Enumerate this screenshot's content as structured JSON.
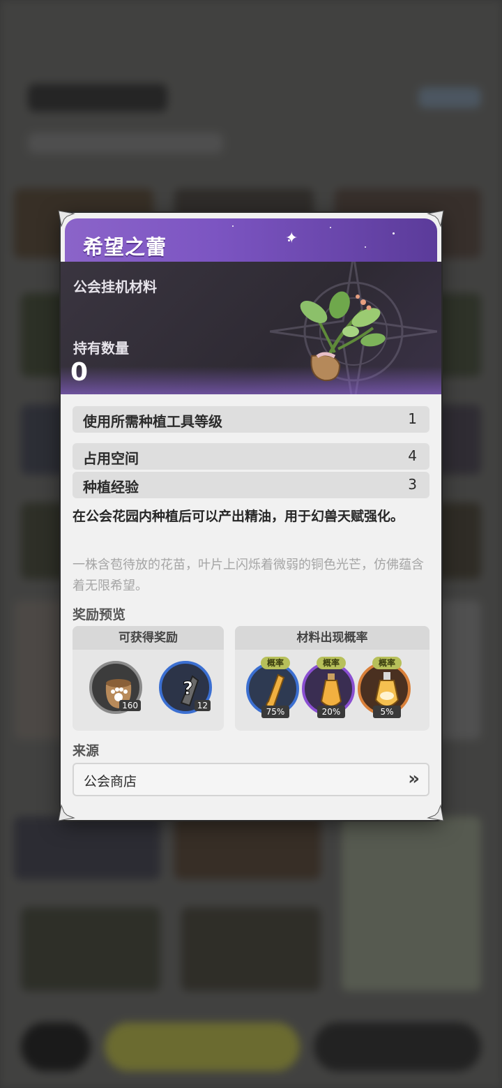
{
  "item": {
    "name": "希望之蕾",
    "category": "公会挂机材料",
    "own_label": "持有数量",
    "own_value": "0"
  },
  "stats": [
    {
      "label": "使用所需种植工具等级",
      "value": "1"
    },
    {
      "label": "占用空间",
      "value": "4"
    },
    {
      "label": "种植经验",
      "value": "3"
    }
  ],
  "description": "在公会花园内种植后可以产出精油，用于幻兽天赋强化。",
  "flavor": "一株含苞待放的花苗，叶片上闪烁着微弱的铜色光芒，仿佛蕴含着无限希望。",
  "rewards": {
    "section_label": "奖励预览",
    "obtainable": {
      "header": "可获得奖励",
      "items": [
        {
          "icon": "paw-sack-icon",
          "qty": "160"
        },
        {
          "icon": "mystery-item-icon",
          "qty": "12"
        }
      ]
    },
    "probability": {
      "header": "材料出现概率",
      "items": [
        {
          "icon": "essence-vial-blue-icon",
          "tag": "概率",
          "rate": "75%",
          "ring": "#3b6fd1"
        },
        {
          "icon": "essence-vial-purple-icon",
          "tag": "概率",
          "rate": "20%",
          "ring": "#8a4fd1"
        },
        {
          "icon": "essence-vial-orange-icon",
          "tag": "概率",
          "rate": "5%",
          "ring": "#d9803a"
        }
      ]
    }
  },
  "source": {
    "section_label": "来源",
    "label": "公会商店",
    "arrow": "»"
  }
}
